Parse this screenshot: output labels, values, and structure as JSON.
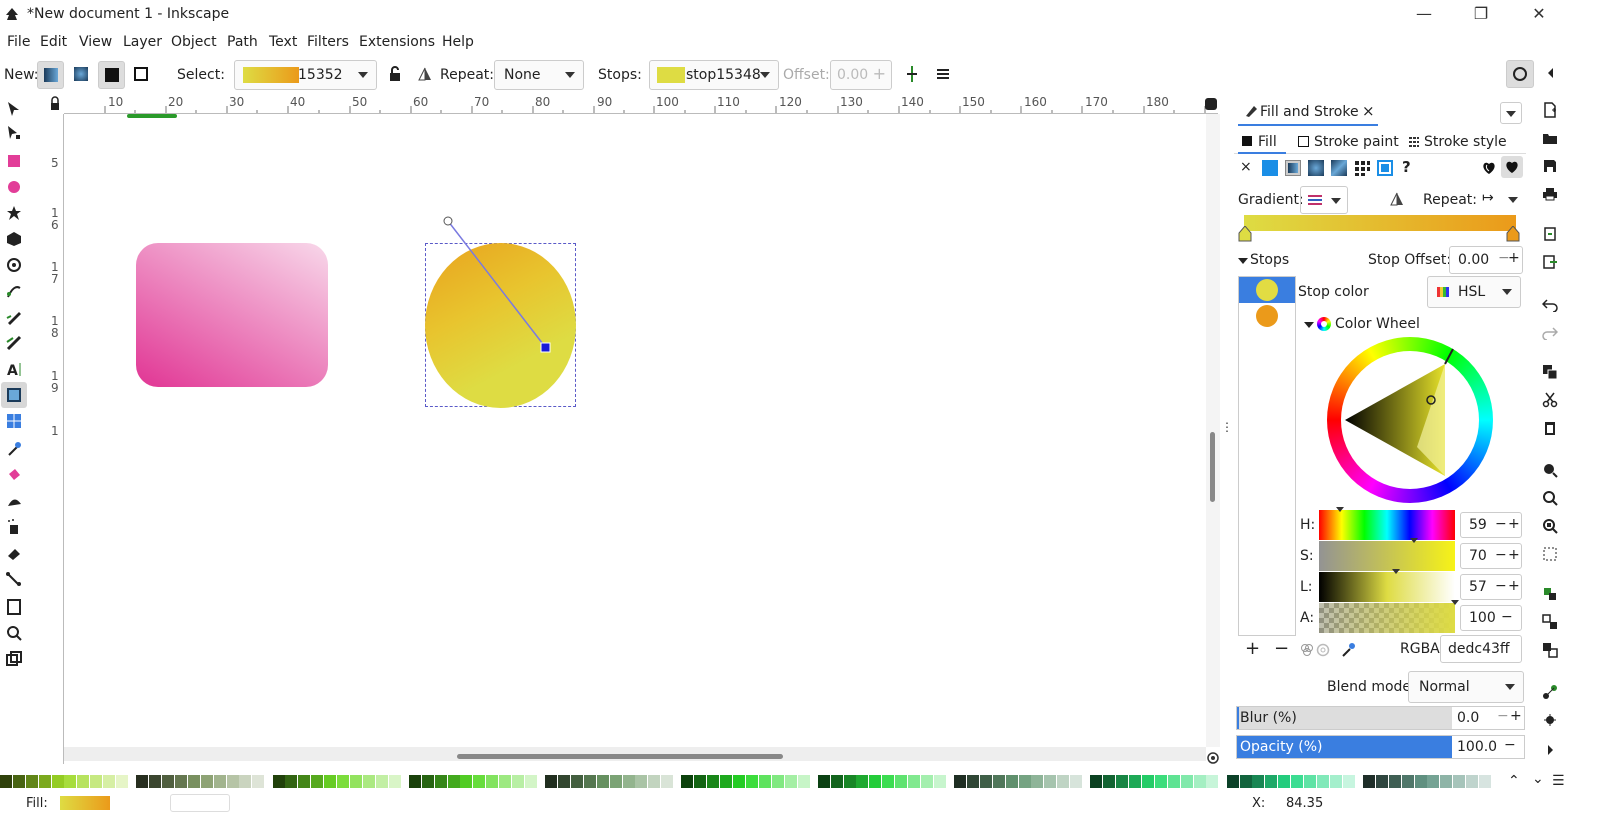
{
  "window": {
    "title": "*New document 1 - Inkscape",
    "minimize_glyph": "—",
    "restore_glyph": "❐",
    "close_glyph": "✕"
  },
  "menu": [
    "File",
    "Edit",
    "View",
    "Layer",
    "Object",
    "Path",
    "Text",
    "Filters",
    "Extensions",
    "Help"
  ],
  "toolbar": {
    "new_label": "New:",
    "select_label": "Select:",
    "select_value": "15352",
    "repeat_label": "Repeat:",
    "repeat_value": "None",
    "stops_label": "Stops:",
    "stops_value": "stop15348",
    "offset_label": "Offset:",
    "offset_value": "0.00"
  },
  "ruler": {
    "top_ticks": [
      "10",
      "20",
      "30",
      "40",
      "50",
      "60",
      "70",
      "80",
      "90",
      "100",
      "110",
      "120",
      "130",
      "140",
      "150",
      "160",
      "170",
      "180"
    ],
    "left_ticks": [
      "5",
      "1",
      "6",
      "1",
      "7",
      "1",
      "8",
      "1",
      "9",
      "1"
    ]
  },
  "dock": {
    "tab_title": "Fill and Stroke",
    "tab_close": "×",
    "subtabs": [
      "Fill",
      "Stroke paint",
      "Stroke style"
    ],
    "fill_none_glyph": "×",
    "unknown_glyph": "?",
    "gradient_label": "Gradient:",
    "repeat_label": "Repeat:",
    "stops_label": "Stops",
    "stop_offset_label": "Stop Offset:",
    "stop_offset_value": "0.00",
    "stop_color_label": "Stop color",
    "color_mode": "HSL",
    "color_wheel_label": "Color Wheel",
    "h_label": "H:",
    "h_value": "59",
    "s_label": "S:",
    "s_value": "70",
    "l_label": "L:",
    "l_value": "57",
    "a_label": "A:",
    "a_value": "100",
    "rgba_label": "RGBA:",
    "rgba_value": "dedc43ff",
    "blend_label": "Blend mode:",
    "blend_value": "Normal",
    "blur_label": "Blur (%)",
    "blur_value": "0.0",
    "opacity_label": "Opacity (%)",
    "opacity_value": "100.0",
    "opacity_fraction": 1.0,
    "stops": [
      {
        "color": "#e2dc43"
      },
      {
        "color": "#eb9a1a"
      }
    ]
  },
  "status": {
    "fill_label": "Fill:",
    "x_label": "X:",
    "x_value": "84.35"
  },
  "colors": {
    "accent": "#3a7ee0",
    "gradient_start": "#e9a21e",
    "gradient_end": "#dedc43",
    "rect_start": "#e23d98",
    "rect_end": "#f8d8ea"
  }
}
